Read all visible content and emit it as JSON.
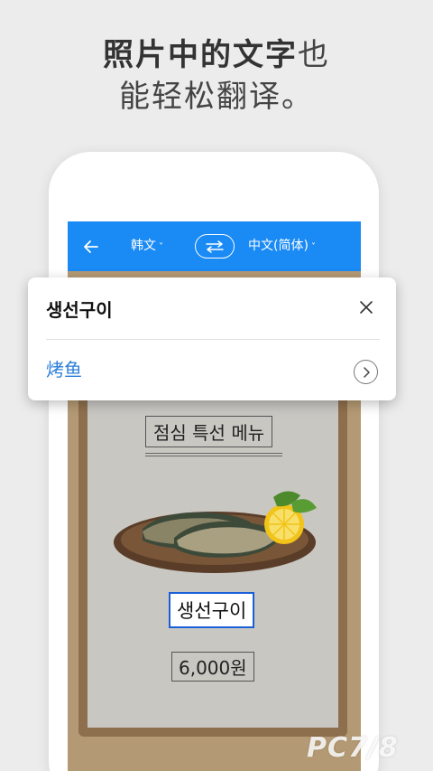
{
  "headline": {
    "line1_bold": "照片中的文字",
    "line1_light": "也",
    "line2": "能轻松翻译。"
  },
  "appbar": {
    "source_lang": "韩文",
    "target_lang": "中文(简体)",
    "back_icon": "arrow-left-icon",
    "swap_icon": "swap-arrows-icon",
    "color": "#1a8af5"
  },
  "card": {
    "source_text": "생선구이",
    "translation": "烤鱼",
    "close_icon": "close-icon",
    "more_icon": "chevron-right-icon",
    "accent": "#2b7fd8"
  },
  "menu_board": {
    "title": "점심 특선 메뉴",
    "dish": "생선구이",
    "price": "6,000원"
  },
  "watermark": "PC7/8"
}
